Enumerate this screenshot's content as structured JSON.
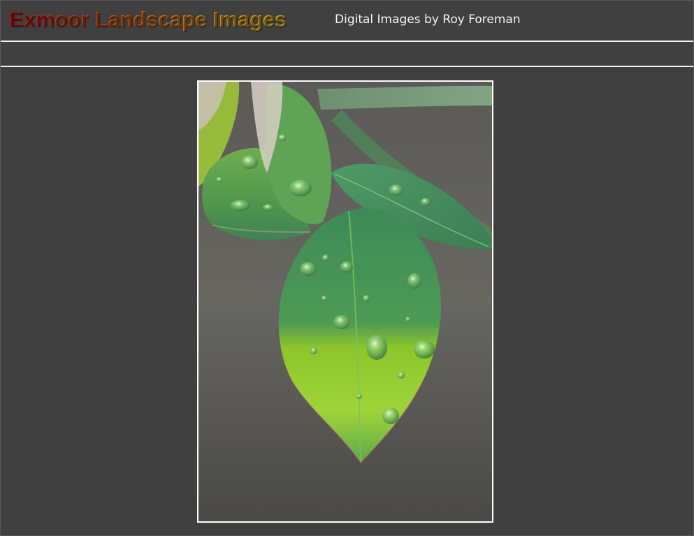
{
  "header": {
    "title": "Exmoor Landscape Images",
    "subtitle": "Digital Images by Roy Foreman"
  },
  "photo": {
    "subject": "rose-leaves-with-water-droplets"
  },
  "colors": {
    "background": "#404040",
    "rule": "#f2f2f2",
    "title_gradient_start": "#cc1010",
    "title_gradient_end": "#f2c21f",
    "subtitle": "#f4f4f4"
  }
}
